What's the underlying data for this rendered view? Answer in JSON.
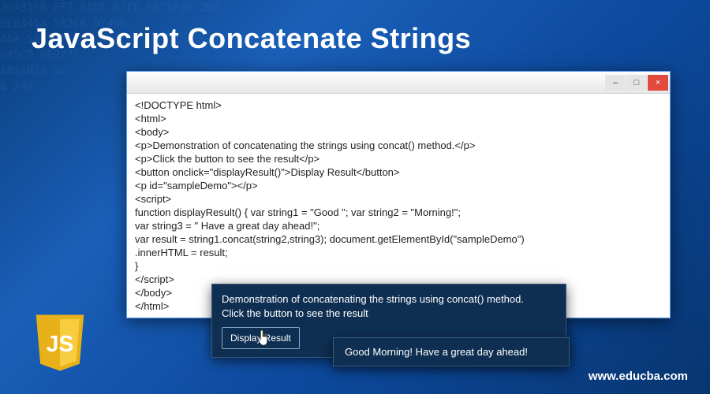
{
  "title": "JavaScript Concatenate Strings",
  "window": {
    "min": "–",
    "max": "□",
    "close": "×"
  },
  "code": "<!DOCTYPE html>\n<html>\n<body>\n<p>Demonstration of concatenating the strings using concat() method.</p>\n<p>Click the button to see the result</p>\n<button onclick=\"displayResult()\">Display Result</button>\n<p id=\"sampleDemo\"></p>\n<script>\nfunction displayResult() { var string1 = \"Good \"; var string2 = \"Morning!\";\nvar string3 = \" Have a great day ahead!\";\nvar result = string1.concat(string2,string3); document.getElementById(\"sampleDemo\")\n.innerHTML = result;\n}\n</script>\n</body>\n</html>",
  "demo": {
    "line1": "Demonstration of concatenating the strings using concat() method.",
    "line2": "Click the button to see the result",
    "button_label": "Display Result"
  },
  "result_text": "Good Morning! Have a great day ahead!",
  "js_logo_text": "JS",
  "website": "www.educba.com"
}
